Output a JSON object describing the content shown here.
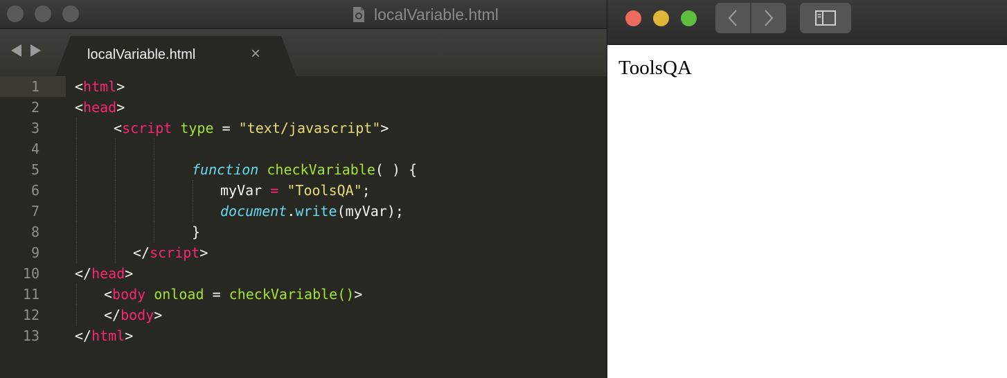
{
  "editor": {
    "window_title": "localVariable.html",
    "tab_label": "localVariable.html",
    "tab_close": "×",
    "lines": [
      {
        "num": "1"
      },
      {
        "num": "2"
      },
      {
        "num": "3"
      },
      {
        "num": "4"
      },
      {
        "num": "5"
      },
      {
        "num": "6"
      },
      {
        "num": "7"
      },
      {
        "num": "8"
      },
      {
        "num": "9"
      },
      {
        "num": "10"
      },
      {
        "num": "11"
      },
      {
        "num": "12"
      },
      {
        "num": "13"
      }
    ],
    "code": {
      "l1_tag": "html",
      "l2_tag": "head",
      "l3_tag": "script",
      "l3_attr": "type",
      "l3_val": "\"text/javascript\"",
      "l5_kw": "function",
      "l5_fn": "checkVariable",
      "l6_var": "myVar",
      "l6_val": "\"ToolsQA\"",
      "l7_obj": "document",
      "l7_method": "write",
      "l7_arg": "myVar",
      "l9_tag": "script",
      "l10_tag": "head",
      "l11_tag": "body",
      "l11_attr": "onload",
      "l11_val": "checkVariable()",
      "l12_tag": "body",
      "l13_tag": "html"
    }
  },
  "browser": {
    "traffic_lights": {
      "close": "#ed6a5e",
      "minimize": "#e1b53a",
      "maximize": "#5fbe3f"
    },
    "back_icon": "chevron-left-icon",
    "forward_icon": "chevron-right-icon",
    "sidebar_icon": "sidebar-icon",
    "page_text": "ToolsQA"
  }
}
